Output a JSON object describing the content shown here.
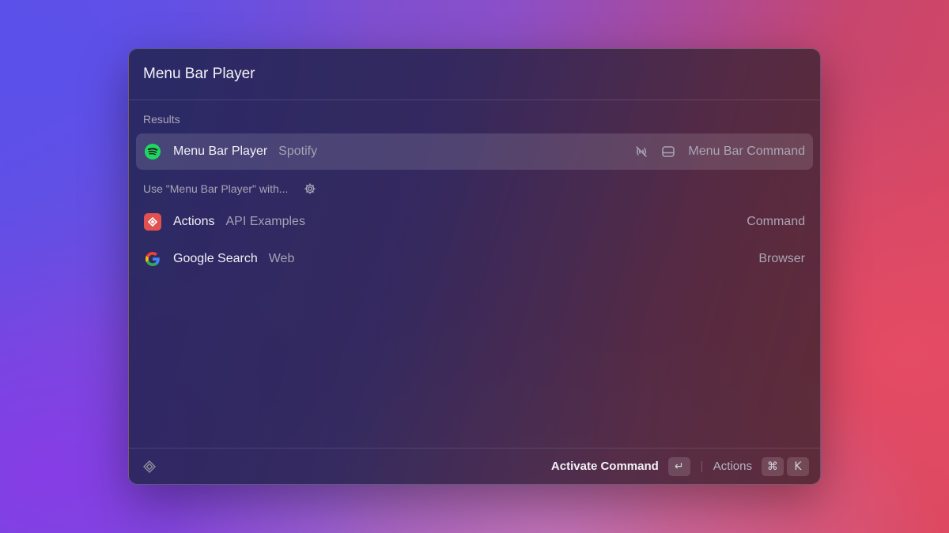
{
  "search": {
    "query": "Menu Bar Player"
  },
  "sections": [
    {
      "title": "Results"
    },
    {
      "title": "Use \"Menu Bar Player\" with..."
    }
  ],
  "items": [
    {
      "title": "Menu Bar Player",
      "subtitle": "Spotify",
      "accessory": "Menu Bar Command",
      "icon": "spotify-icon",
      "selected": true
    },
    {
      "title": "Actions",
      "subtitle": "API Examples",
      "accessory": "Command",
      "icon": "raycast-actions-icon"
    },
    {
      "title": "Google Search",
      "subtitle": "Web",
      "accessory": "Browser",
      "icon": "google-icon"
    }
  ],
  "footer": {
    "primary_action": "Activate Command",
    "primary_key": "↵",
    "secondary_action": "Actions",
    "secondary_keys": [
      "⌘",
      "K"
    ]
  },
  "colors": {
    "spotify": "#1ed760",
    "actions_icon": "#e0514f"
  }
}
